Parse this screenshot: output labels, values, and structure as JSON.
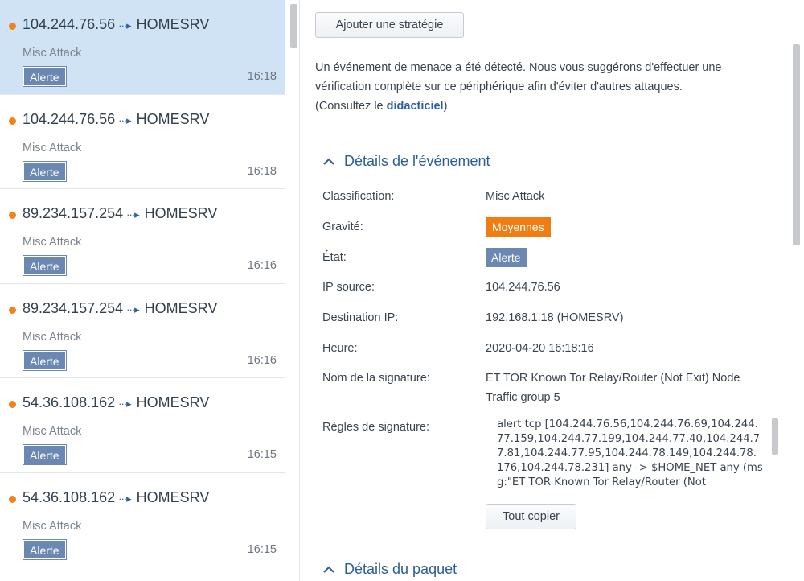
{
  "events": [
    {
      "source": "104.244.76.56",
      "dest": "HOMESRV",
      "type": "Misc Attack",
      "status": "Alerte",
      "time": "16:18"
    },
    {
      "source": "104.244.76.56",
      "dest": "HOMESRV",
      "type": "Misc Attack",
      "status": "Alerte",
      "time": "16:18"
    },
    {
      "source": "89.234.157.254",
      "dest": "HOMESRV",
      "type": "Misc Attack",
      "status": "Alerte",
      "time": "16:16"
    },
    {
      "source": "89.234.157.254",
      "dest": "HOMESRV",
      "type": "Misc Attack",
      "status": "Alerte",
      "time": "16:16"
    },
    {
      "source": "54.36.108.162",
      "dest": "HOMESRV",
      "type": "Misc Attack",
      "status": "Alerte",
      "time": "16:15"
    },
    {
      "source": "54.36.108.162",
      "dest": "HOMESRV",
      "type": "Misc Attack",
      "status": "Alerte",
      "time": "16:15"
    }
  ],
  "arrow_glyph": "···▸",
  "detail": {
    "add_strategy_label": "Ajouter une stratégie",
    "intro_line1": "Un événement de menace a été détecté. Nous vous suggérons d'effectuer une",
    "intro_line2": "vérification complète sur ce périphérique afin d'éviter d'autres attaques.",
    "intro_prefix": "(Consultez le ",
    "intro_link": "didacticiel",
    "intro_suffix": ")",
    "event_section_title": "Détails de l'événement",
    "packet_section_title": "Détails du paquet",
    "fields": {
      "classification_label": "Classification:",
      "classification_value": "Misc Attack",
      "severity_label": "Gravité:",
      "severity_value": "Moyennes",
      "state_label": "État:",
      "state_value": "Alerte",
      "source_ip_label": "IP source:",
      "source_ip_value": "104.244.76.56",
      "dest_ip_label": "Destination IP:",
      "dest_ip_value": "192.168.1.18 (HOMESRV)",
      "time_label": "Heure:",
      "time_value": "2020-04-20 16:18:16",
      "signature_name_label": "Nom de la signature:",
      "signature_name_line1": "ET TOR Known Tor Relay/Router (Not Exit) Node",
      "signature_name_line2": "Traffic group 5",
      "signature_rules_label": "Règles de signature:",
      "signature_rules_value": "alert tcp [104.244.76.56,104.244.76.69,104.244.77.159,104.244.77.199,104.244.77.40,104.244.77.81,104.244.77.95,104.244.78.149,104.244.78.176,104.244.78.231] any -> $HOME_NET any (msg:\"ET TOR Known Tor Relay/Router (Not"
    },
    "copy_all_label": "Tout copier"
  },
  "colors": {
    "selected_bg": "#cfe3f5",
    "dot": "#f0831c",
    "badge_alert": "#6a88b1",
    "badge_severity": "#ef7d12",
    "section_title": "#2d5c97",
    "link": "#2c5fa6"
  },
  "icons": {
    "dot": "severity-dot-icon",
    "arrow": "arrow-right-icon",
    "section_toggle": "chevron-up-icon"
  }
}
